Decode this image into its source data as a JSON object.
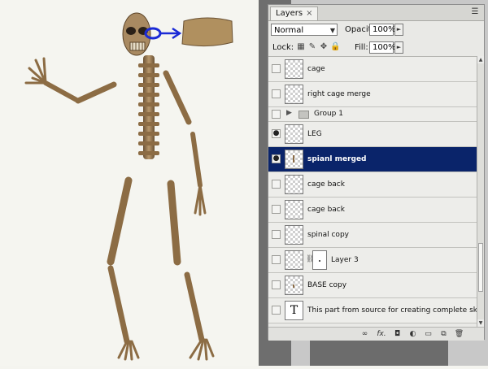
{
  "panel": {
    "tab_label": "Layers",
    "tab_close": "×",
    "blend_mode": "Normal",
    "opacity_label": "Opacity:",
    "opacity_value": "100%",
    "lock_label": "Lock:",
    "fill_label": "Fill:",
    "fill_value": "100%"
  },
  "layers": [
    {
      "name": "cage",
      "visible": false,
      "selected": false
    },
    {
      "name": "right  cage merge",
      "visible": false,
      "selected": false
    },
    {
      "name": "Group 1",
      "visible": false,
      "selected": false,
      "kind": "group"
    },
    {
      "name": "LEG",
      "visible": true,
      "selected": false
    },
    {
      "name": "spianl merged",
      "visible": true,
      "selected": true
    },
    {
      "name": "cage back",
      "visible": false,
      "selected": false
    },
    {
      "name": "cage back",
      "visible": false,
      "selected": false
    },
    {
      "name": "spinal copy",
      "visible": false,
      "selected": false
    },
    {
      "name": "Layer 3",
      "visible": false,
      "selected": false,
      "kind": "masked"
    },
    {
      "name": "BASE copy",
      "visible": false,
      "selected": false
    },
    {
      "name": "This part from source for creating complete skeleton",
      "visible": false,
      "selected": false,
      "kind": "text",
      "thumb_glyph": "T"
    }
  ],
  "icons": {
    "eye": "eye-icon",
    "link": "link-layers-icon",
    "fx": "layer-style-icon",
    "mask": "add-mask-icon",
    "adjust": "adjustment-layer-icon",
    "group": "new-group-icon",
    "new": "new-layer-icon",
    "trash": "delete-layer-icon"
  },
  "footer": {
    "fx_label": "fx."
  },
  "colors": {
    "selected_row": "#0a246a",
    "bone": "#9a7a52",
    "annotation_blue": "#1a2ad6"
  }
}
